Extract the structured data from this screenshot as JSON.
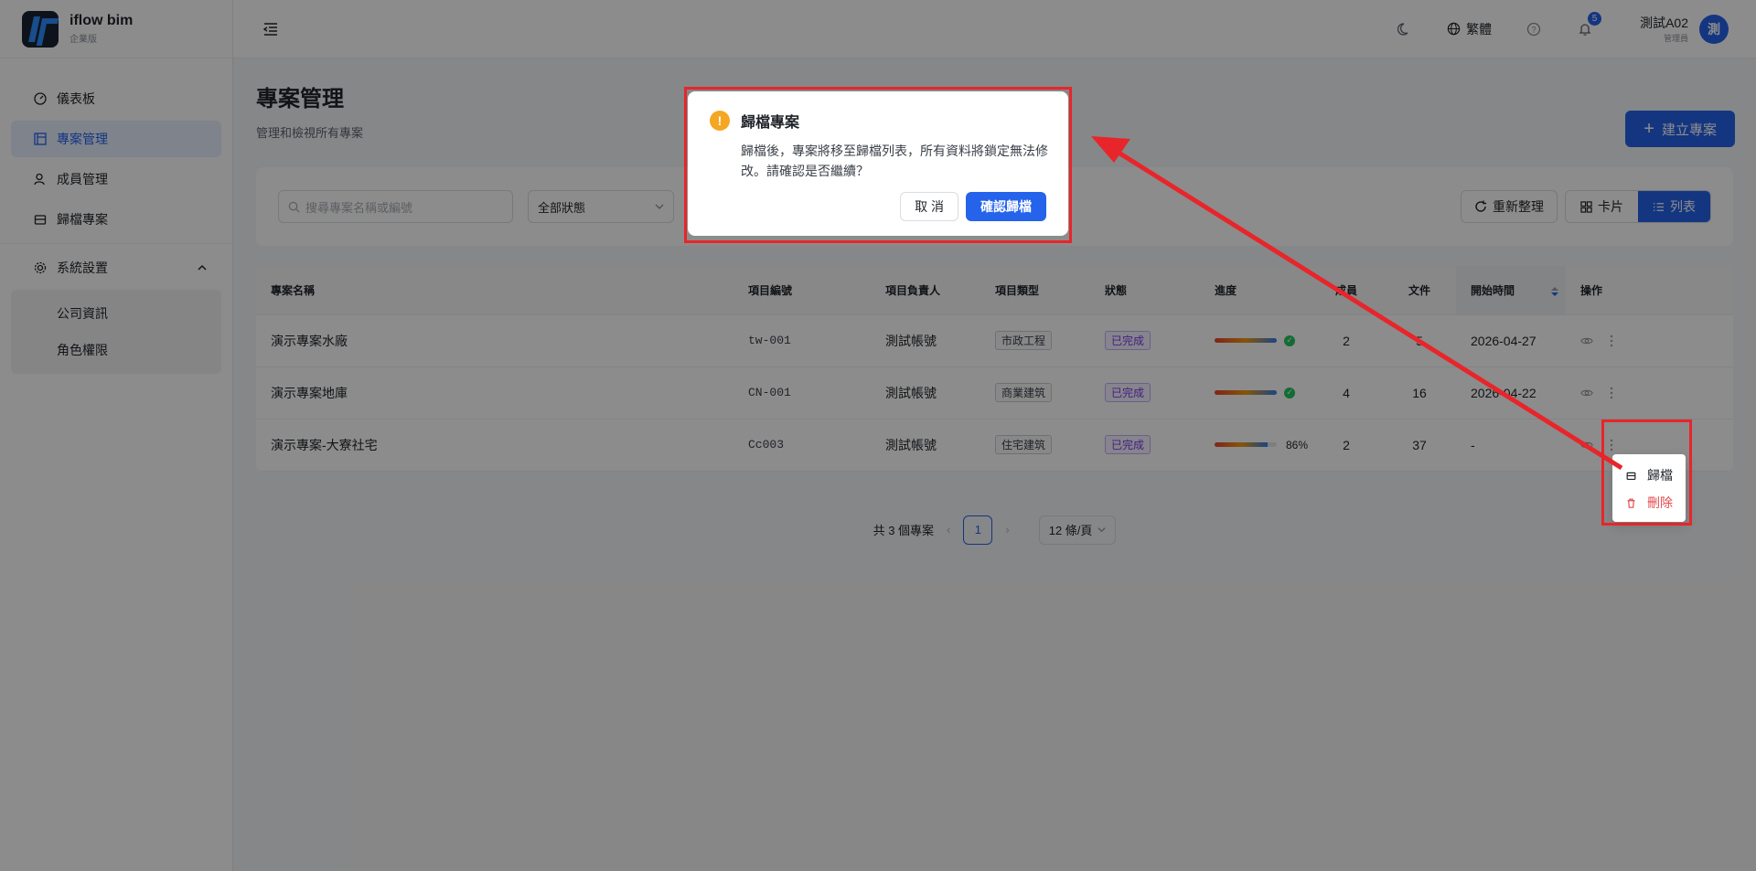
{
  "brand": {
    "name": "iflow bim",
    "sub": "企業版"
  },
  "sidebar": {
    "items": [
      {
        "label": "儀表板",
        "icon": "dashboard-icon"
      },
      {
        "label": "專案管理",
        "icon": "project-icon"
      },
      {
        "label": "成員管理",
        "icon": "members-icon"
      },
      {
        "label": "歸檔專案",
        "icon": "archive-icon"
      }
    ],
    "group": {
      "label": "系統設置",
      "icon": "gear-icon",
      "children": [
        "公司資訊",
        "角色權限"
      ]
    }
  },
  "header": {
    "language": "繁體",
    "notification_count": "5",
    "user_name": "測試A02",
    "user_role": "管理員",
    "avatar_text": "測"
  },
  "page": {
    "title": "專案管理",
    "subtitle": "管理和檢視所有專案",
    "create_label": "建立專案"
  },
  "filters": {
    "search_placeholder": "搜尋專案名稱或編號",
    "status_value": "全部狀態",
    "refresh_label": "重新整理",
    "card_label": "卡片",
    "list_label": "列表"
  },
  "table": {
    "columns": [
      "專案名稱",
      "項目編號",
      "項目負責人",
      "項目類型",
      "狀態",
      "進度",
      "成員",
      "文件",
      "開始時間",
      "操作"
    ],
    "rows": [
      {
        "name": "演示專案水廠",
        "code": "tw-001",
        "owner": "測試帳號",
        "type": "市政工程",
        "status": "已完成",
        "progress": 100,
        "progress_text": "",
        "members": "2",
        "files": "5",
        "start": "2026-04-27"
      },
      {
        "name": "演示專案地庫",
        "code": "CN-001",
        "owner": "測試帳號",
        "type": "商業建筑",
        "status": "已完成",
        "progress": 100,
        "progress_text": "",
        "members": "4",
        "files": "16",
        "start": "2026-04-22"
      },
      {
        "name": "演示專案-大寮社宅",
        "code": "Cc003",
        "owner": "測試帳號",
        "type": "住宅建筑",
        "status": "已完成",
        "progress": 86,
        "progress_text": "86%",
        "members": "2",
        "files": "37",
        "start": "-"
      }
    ]
  },
  "pagination": {
    "total_text": "共 3 個專案",
    "current_page": "1",
    "page_size": "12 條/頁"
  },
  "row_menu": {
    "archive": "歸檔",
    "delete": "刪除"
  },
  "modal": {
    "title": "歸檔專案",
    "body": "歸檔後，專案將移至歸檔列表，所有資料將鎖定無法修改。請確認是否繼續？",
    "cancel": "取 消",
    "confirm": "確認歸檔"
  },
  "colors": {
    "accent": "#2563eb",
    "annotation": "#e8252a",
    "warning": "#f5a623"
  }
}
